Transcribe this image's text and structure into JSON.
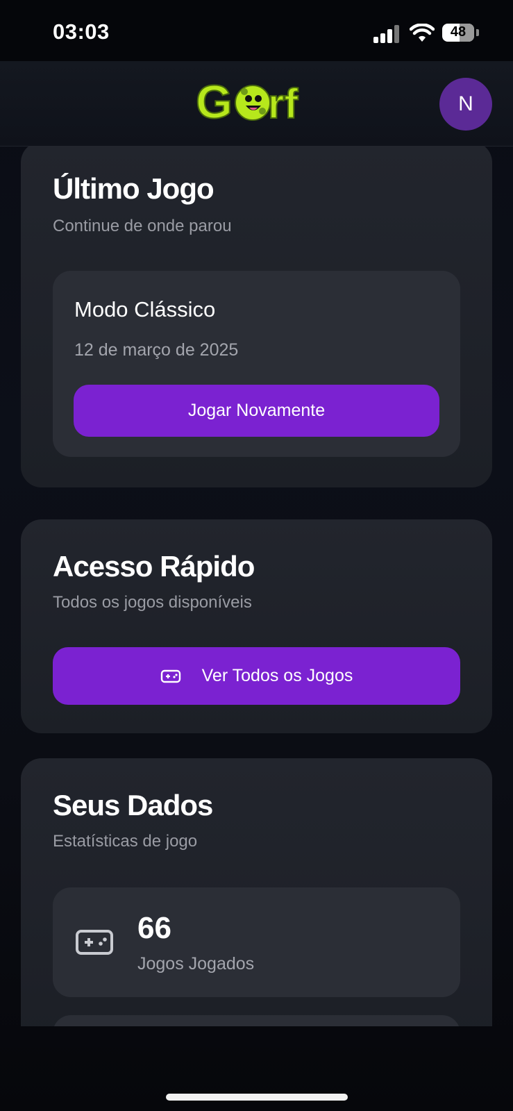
{
  "status_bar": {
    "time": "03:03",
    "battery": "48"
  },
  "header": {
    "logo_text": "Gorf",
    "avatar_initial": "N"
  },
  "last_game": {
    "title": "Último Jogo",
    "subtitle": "Continue de onde parou",
    "game_mode": "Modo Clássico",
    "date": "12 de março de 2025",
    "play_again_label": "Jogar Novamente"
  },
  "quick_access": {
    "title": "Acesso Rápido",
    "subtitle": "Todos os jogos disponíveis",
    "view_all_label": "Ver Todos os Jogos"
  },
  "your_data": {
    "title": "Seus Dados",
    "subtitle": "Estatísticas de jogo",
    "stats": [
      {
        "value": "66",
        "label": "Jogos Jogados",
        "icon": "gamepad-icon"
      }
    ]
  },
  "colors": {
    "accent": "#7b22d1",
    "avatar": "#5b2a96",
    "logo_green": "#b7e81c"
  }
}
